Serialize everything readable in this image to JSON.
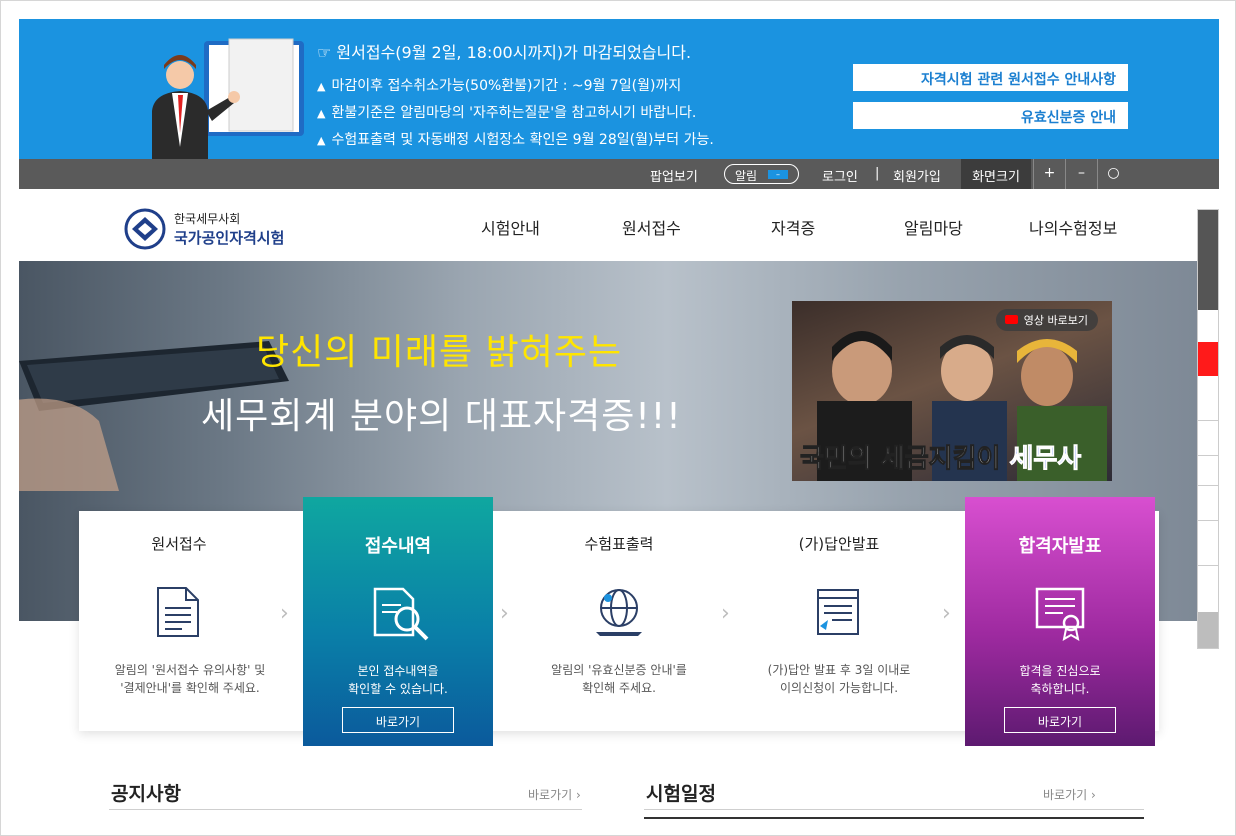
{
  "notice": {
    "headline": "☞ 원서접수(9월 2일, 18:00시까지)가 마감되었습니다.",
    "bullets": [
      "마감이후 접수취소가능(50%환불)기간 : ~9월 7일(월)까지",
      "환불기준은 알림마당의 '자주하는질문'을 참고하시기 바랍니다.",
      "수험표출력 및 자동배정 시험장소 확인은 9월 28일(월)부터 가능."
    ],
    "buttons": [
      "자격시험 관련 원서접수 안내사항",
      "유효신분증 안내"
    ]
  },
  "util": {
    "popup": "팝업보기",
    "alarm": "알림",
    "alarm_state": "–",
    "login": "로그인",
    "sep": "|",
    "signup": "회원가입",
    "screen_size": "화면크기",
    "plus": "+",
    "minus": "–",
    "reset": "○"
  },
  "logo": {
    "line1": "한국세무사회",
    "line2": "국가공인자격시험"
  },
  "nav": [
    "시험안내",
    "원서접수",
    "자격증",
    "알림마당",
    "나의수험정보"
  ],
  "hero": {
    "headline1": "당신의 미래를 밝혀주는",
    "headline2": "세무회계 분야의 대표자격증!!!",
    "video_badge": "영상 바로보기",
    "video_caption_a": "국민의 세금지킴이 ",
    "video_caption_b": "세무사"
  },
  "cards": [
    {
      "title": "원서접수",
      "desc1": "알림의 '원서접수 유의사항' 및",
      "desc2": "'결제안내'를 확인해 주세요."
    },
    {
      "title": "접수내역",
      "desc1": "본인 접수내역을",
      "desc2": "확인할 수 있습니다.",
      "go": "바로가기"
    },
    {
      "title": "수험표출력",
      "desc1": "알림의 '유효신분증 안내'를",
      "desc2": "확인해 주세요."
    },
    {
      "title": "(가)답안발표",
      "desc1": "(가)답안 발표 후 3일 이내로",
      "desc2": "이의신청이 가능합니다."
    },
    {
      "title": "합격자발표",
      "desc1": "합격을 진심으로",
      "desc2": "축하합니다.",
      "go": "바로가기"
    }
  ],
  "arrow": "›",
  "sections": [
    {
      "title": "공지사항",
      "more": "바로가기 ›"
    },
    {
      "title": "시험일정",
      "more": "바로가기 ›"
    }
  ],
  "colors": {
    "banner": "#1b93e0",
    "util_bar": "#5a5a5a",
    "teal_card": "#0fa7a0",
    "magenta_card": "#b03ab0",
    "hero_yellow": "#ffe500"
  }
}
